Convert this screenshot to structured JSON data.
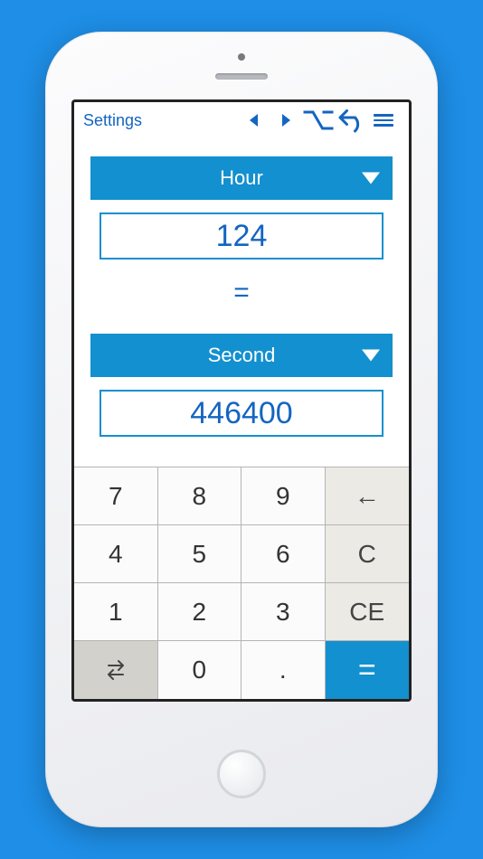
{
  "toolbar": {
    "settings_label": "Settings"
  },
  "conversion": {
    "from_unit": "Hour",
    "from_value": "124",
    "equals_sign": "=",
    "to_unit": "Second",
    "to_value": "446400"
  },
  "keypad": {
    "k7": "7",
    "k8": "8",
    "k9": "9",
    "k4": "4",
    "k5": "5",
    "k6": "6",
    "k1": "1",
    "k2": "2",
    "k3": "3",
    "k0": "0",
    "dot": ".",
    "backspace": "←",
    "clear": "C",
    "clear_entry": "CE",
    "equals": "="
  },
  "colors": {
    "accent": "#1390cf",
    "link": "#1465c0",
    "bg": "#1e8ee6"
  }
}
